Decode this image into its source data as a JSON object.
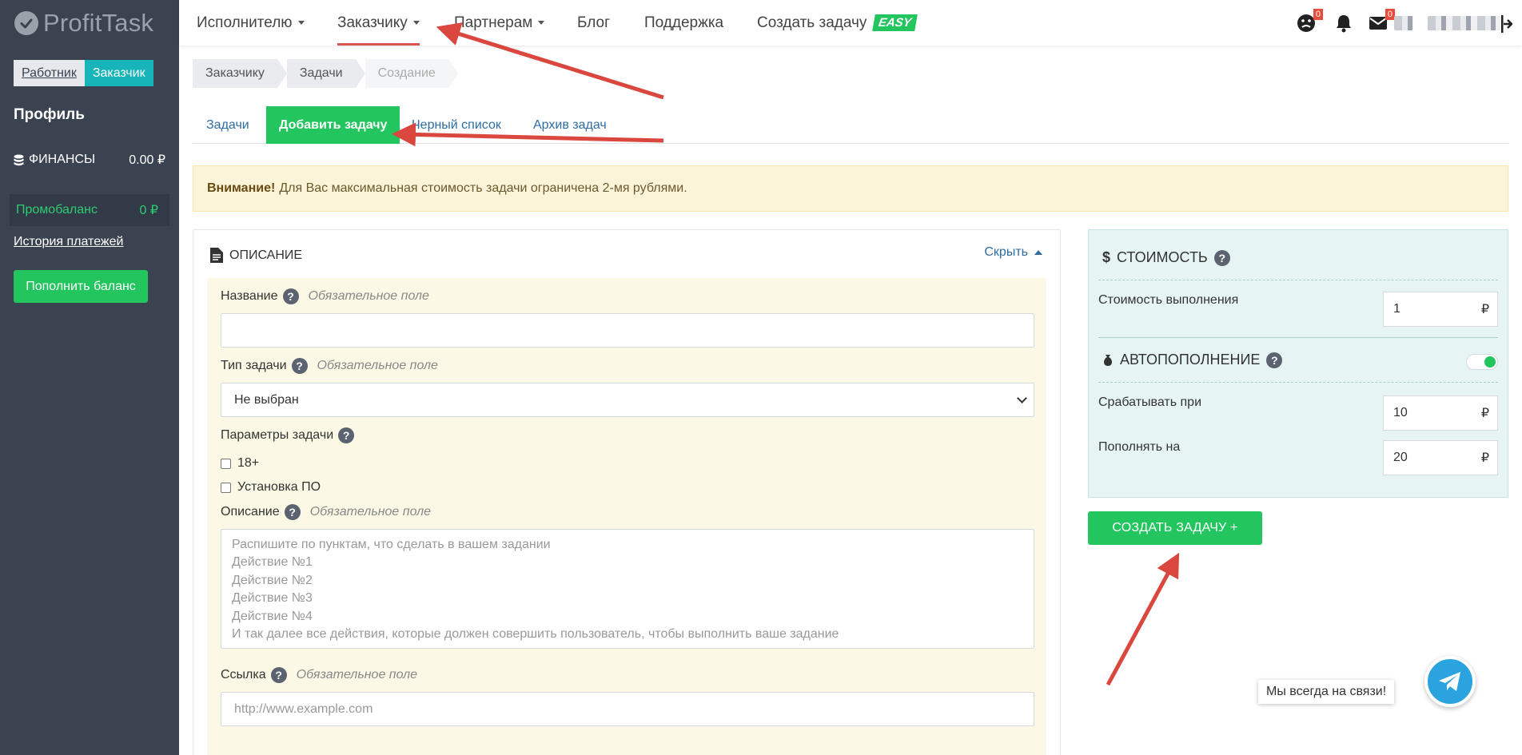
{
  "brand": {
    "name": "ProfitTask"
  },
  "sidebar": {
    "role_worker": "Работник",
    "role_customer": "Заказчик",
    "profile": "Профиль",
    "finance_label": "ФИНАНСЫ",
    "finance_value": "0.00 ₽",
    "promo_label": "Промобаланс",
    "promo_value": "0  ₽",
    "history_link": "История платежей",
    "topup_button": "Пополнить баланс"
  },
  "topnav": {
    "items": [
      {
        "label": "Исполнителю"
      },
      {
        "label": "Заказчику"
      },
      {
        "label": "Партнерам"
      },
      {
        "label": "Блог"
      },
      {
        "label": "Поддержка"
      },
      {
        "label": "Создать задачу"
      }
    ],
    "easy_badge": "EASY",
    "badges": {
      "rating": "0",
      "messages": "0"
    }
  },
  "breadcrumb": [
    "Заказчику",
    "Задачи",
    "Создание"
  ],
  "tabs": [
    "Задачи",
    "Добавить задачу",
    "Черный список",
    "Архив задач"
  ],
  "alert": {
    "strong": "Внимание!",
    "text": "Для Вас максимальная стоимость задачи ограничена 2-мя рублями."
  },
  "description": {
    "title": "ОПИСАНИЕ",
    "hide_link": "Скрыть",
    "required_text": "Обязательное поле",
    "name_label": "Название",
    "type_label": "Тип задачи",
    "type_value": "Не выбран",
    "params_label": "Параметры задачи",
    "params": [
      "18+",
      "Установка ПО"
    ],
    "desc_label": "Описание",
    "desc_placeholder": [
      "Распишите по пунктам, что сделать в вашем задании",
      "Действие №1",
      "Действие №2",
      "Действие №3",
      "Действие №4",
      "И так далее все действия, которые должен совершить пользователь, чтобы выполнить ваше задание"
    ],
    "link_label": "Ссылка",
    "link_placeholder": "http://www.example.com"
  },
  "cost": {
    "title": "СТОИМОСТЬ",
    "exec_label": "Стоимость выполнения",
    "exec_value": "1",
    "currency": "₽",
    "auto_title": "АВТОПОПОЛНЕНИЕ",
    "auto_enabled": true,
    "trigger_label": "Срабатывать при",
    "trigger_value": "10",
    "refill_label": "Пополнять на",
    "refill_value": "20"
  },
  "create_button": "СОЗДАТЬ ЗАДАЧУ +",
  "chat": {
    "text": "Мы всегда на связи!"
  },
  "colors": {
    "accent_green": "#22c55e",
    "sidebar_bg": "#3b4351",
    "teal": "#17b5b9",
    "annotation_red": "#d9473f"
  }
}
